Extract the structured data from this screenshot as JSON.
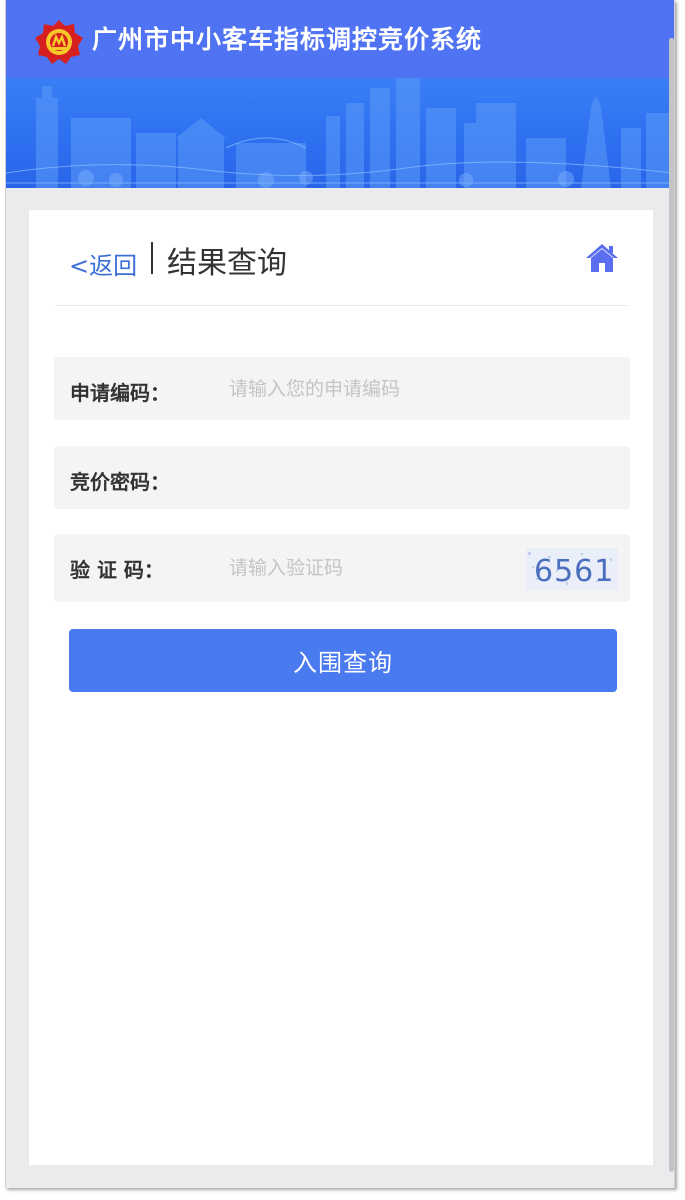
{
  "app": {
    "title": "广州市中小客车指标调控竞价系统"
  },
  "header": {
    "back_label": "<返回",
    "page_title": "结果查询"
  },
  "form": {
    "application_code": {
      "label": "申请编码：",
      "placeholder": "请输入您的申请编码",
      "value": ""
    },
    "bid_password": {
      "label": "竞价密码：",
      "placeholder": "",
      "value": ""
    },
    "captcha": {
      "label": "验 证 码：",
      "placeholder": "请输入验证码",
      "value": "",
      "image_text": "6561"
    },
    "submit_label": "入围查询"
  },
  "colors": {
    "topbar": "#4f73f3",
    "banner": "#2c6ff0",
    "accent": "#4a7af0",
    "link": "#3d6fd8",
    "home_icon": "#5b6ef0"
  },
  "icons": {
    "logo": "emblem-logo-icon",
    "home": "home-icon",
    "scrollbar": "scrollbar"
  }
}
